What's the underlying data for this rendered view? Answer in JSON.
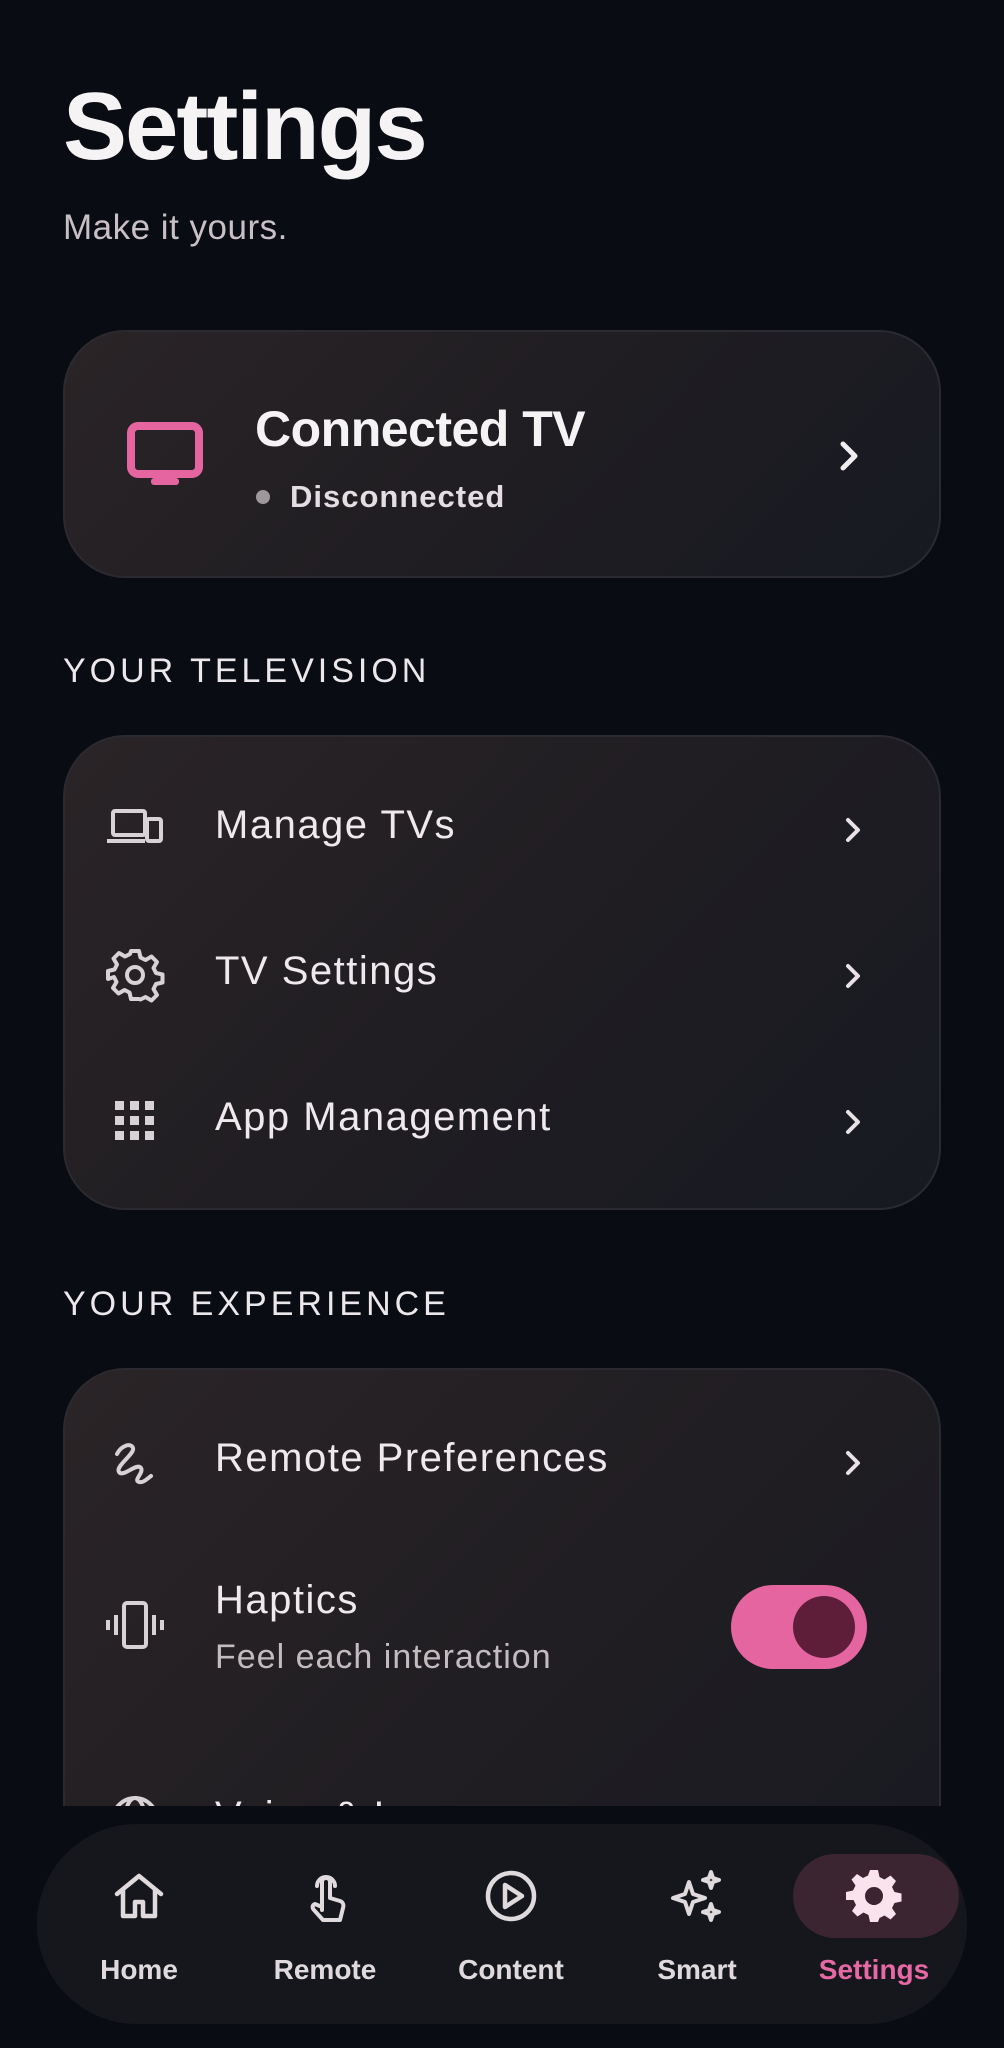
{
  "header": {
    "title": "Settings",
    "subtitle": "Make it yours."
  },
  "connected_tv": {
    "title": "Connected TV",
    "status": "Disconnected",
    "icon": "tv-icon"
  },
  "sections": {
    "television": {
      "label": "YOUR TELEVISION",
      "items": [
        {
          "label": "Manage TVs",
          "icon": "devices-icon"
        },
        {
          "label": "TV Settings",
          "icon": "gear-icon"
        },
        {
          "label": "App Management",
          "icon": "apps-grid-icon"
        }
      ]
    },
    "experience": {
      "label": "YOUR EXPERIENCE",
      "items": [
        {
          "label": "Remote Preferences",
          "icon": "gesture-icon"
        },
        {
          "label": "Haptics",
          "sublabel": "Feel each interaction",
          "icon": "vibration-icon",
          "toggle_on": true
        },
        {
          "label": "Voice & Language",
          "icon": "globe-icon"
        }
      ]
    }
  },
  "bottom_nav": {
    "items": [
      {
        "label": "Home",
        "icon": "home-icon"
      },
      {
        "label": "Remote",
        "icon": "touch-icon"
      },
      {
        "label": "Content",
        "icon": "play-circle-icon"
      },
      {
        "label": "Smart",
        "icon": "sparkle-icon"
      },
      {
        "label": "Settings",
        "icon": "gear-icon",
        "active": true
      }
    ]
  },
  "colors": {
    "accent": "#e565a1",
    "background": "#090c12",
    "toggle_knob": "#5e1d39"
  }
}
